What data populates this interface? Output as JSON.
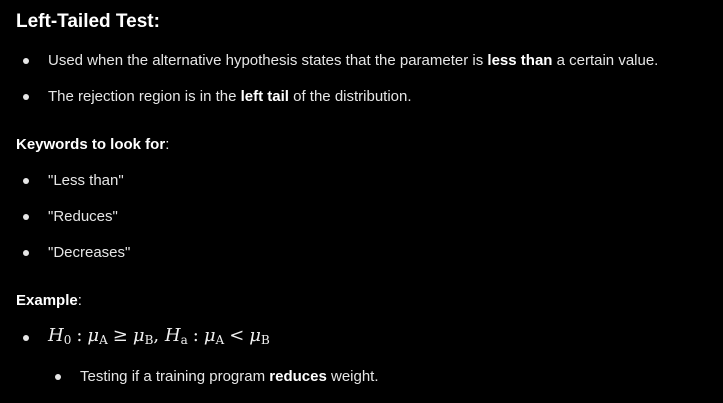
{
  "heading": "Left-Tailed Test:",
  "bullets": [
    {
      "pre": "Used when the alternative hypothesis states that the parameter is ",
      "bold": "less than",
      "post": " a certain value."
    },
    {
      "pre": "The rejection region is in the ",
      "bold": "left tail",
      "post": " of the distribution."
    }
  ],
  "keywords": {
    "label": "Keywords to look for",
    "colon": ":",
    "items": [
      "\"Less than\"",
      "\"Reduces\"",
      "\"Decreases\""
    ]
  },
  "example": {
    "label": "Example",
    "colon": ":",
    "formula": {
      "h0": "H",
      "h0_sub": "0",
      "colon1": ":",
      "mu_a1": "μ",
      "mu_a1_sub": "A",
      "geq": "≥",
      "mu_b1": "μ",
      "mu_b1_sub": "B",
      "comma": ",",
      "ha": "H",
      "ha_sub": "a",
      "colon2": ":",
      "mu_a2": "μ",
      "mu_a2_sub": "A",
      "lt": "<",
      "mu_b2": "μ",
      "mu_b2_sub": "B"
    },
    "sub_bullet": {
      "pre": "Testing if a training program ",
      "bold": "reduces",
      "post": " weight."
    }
  }
}
